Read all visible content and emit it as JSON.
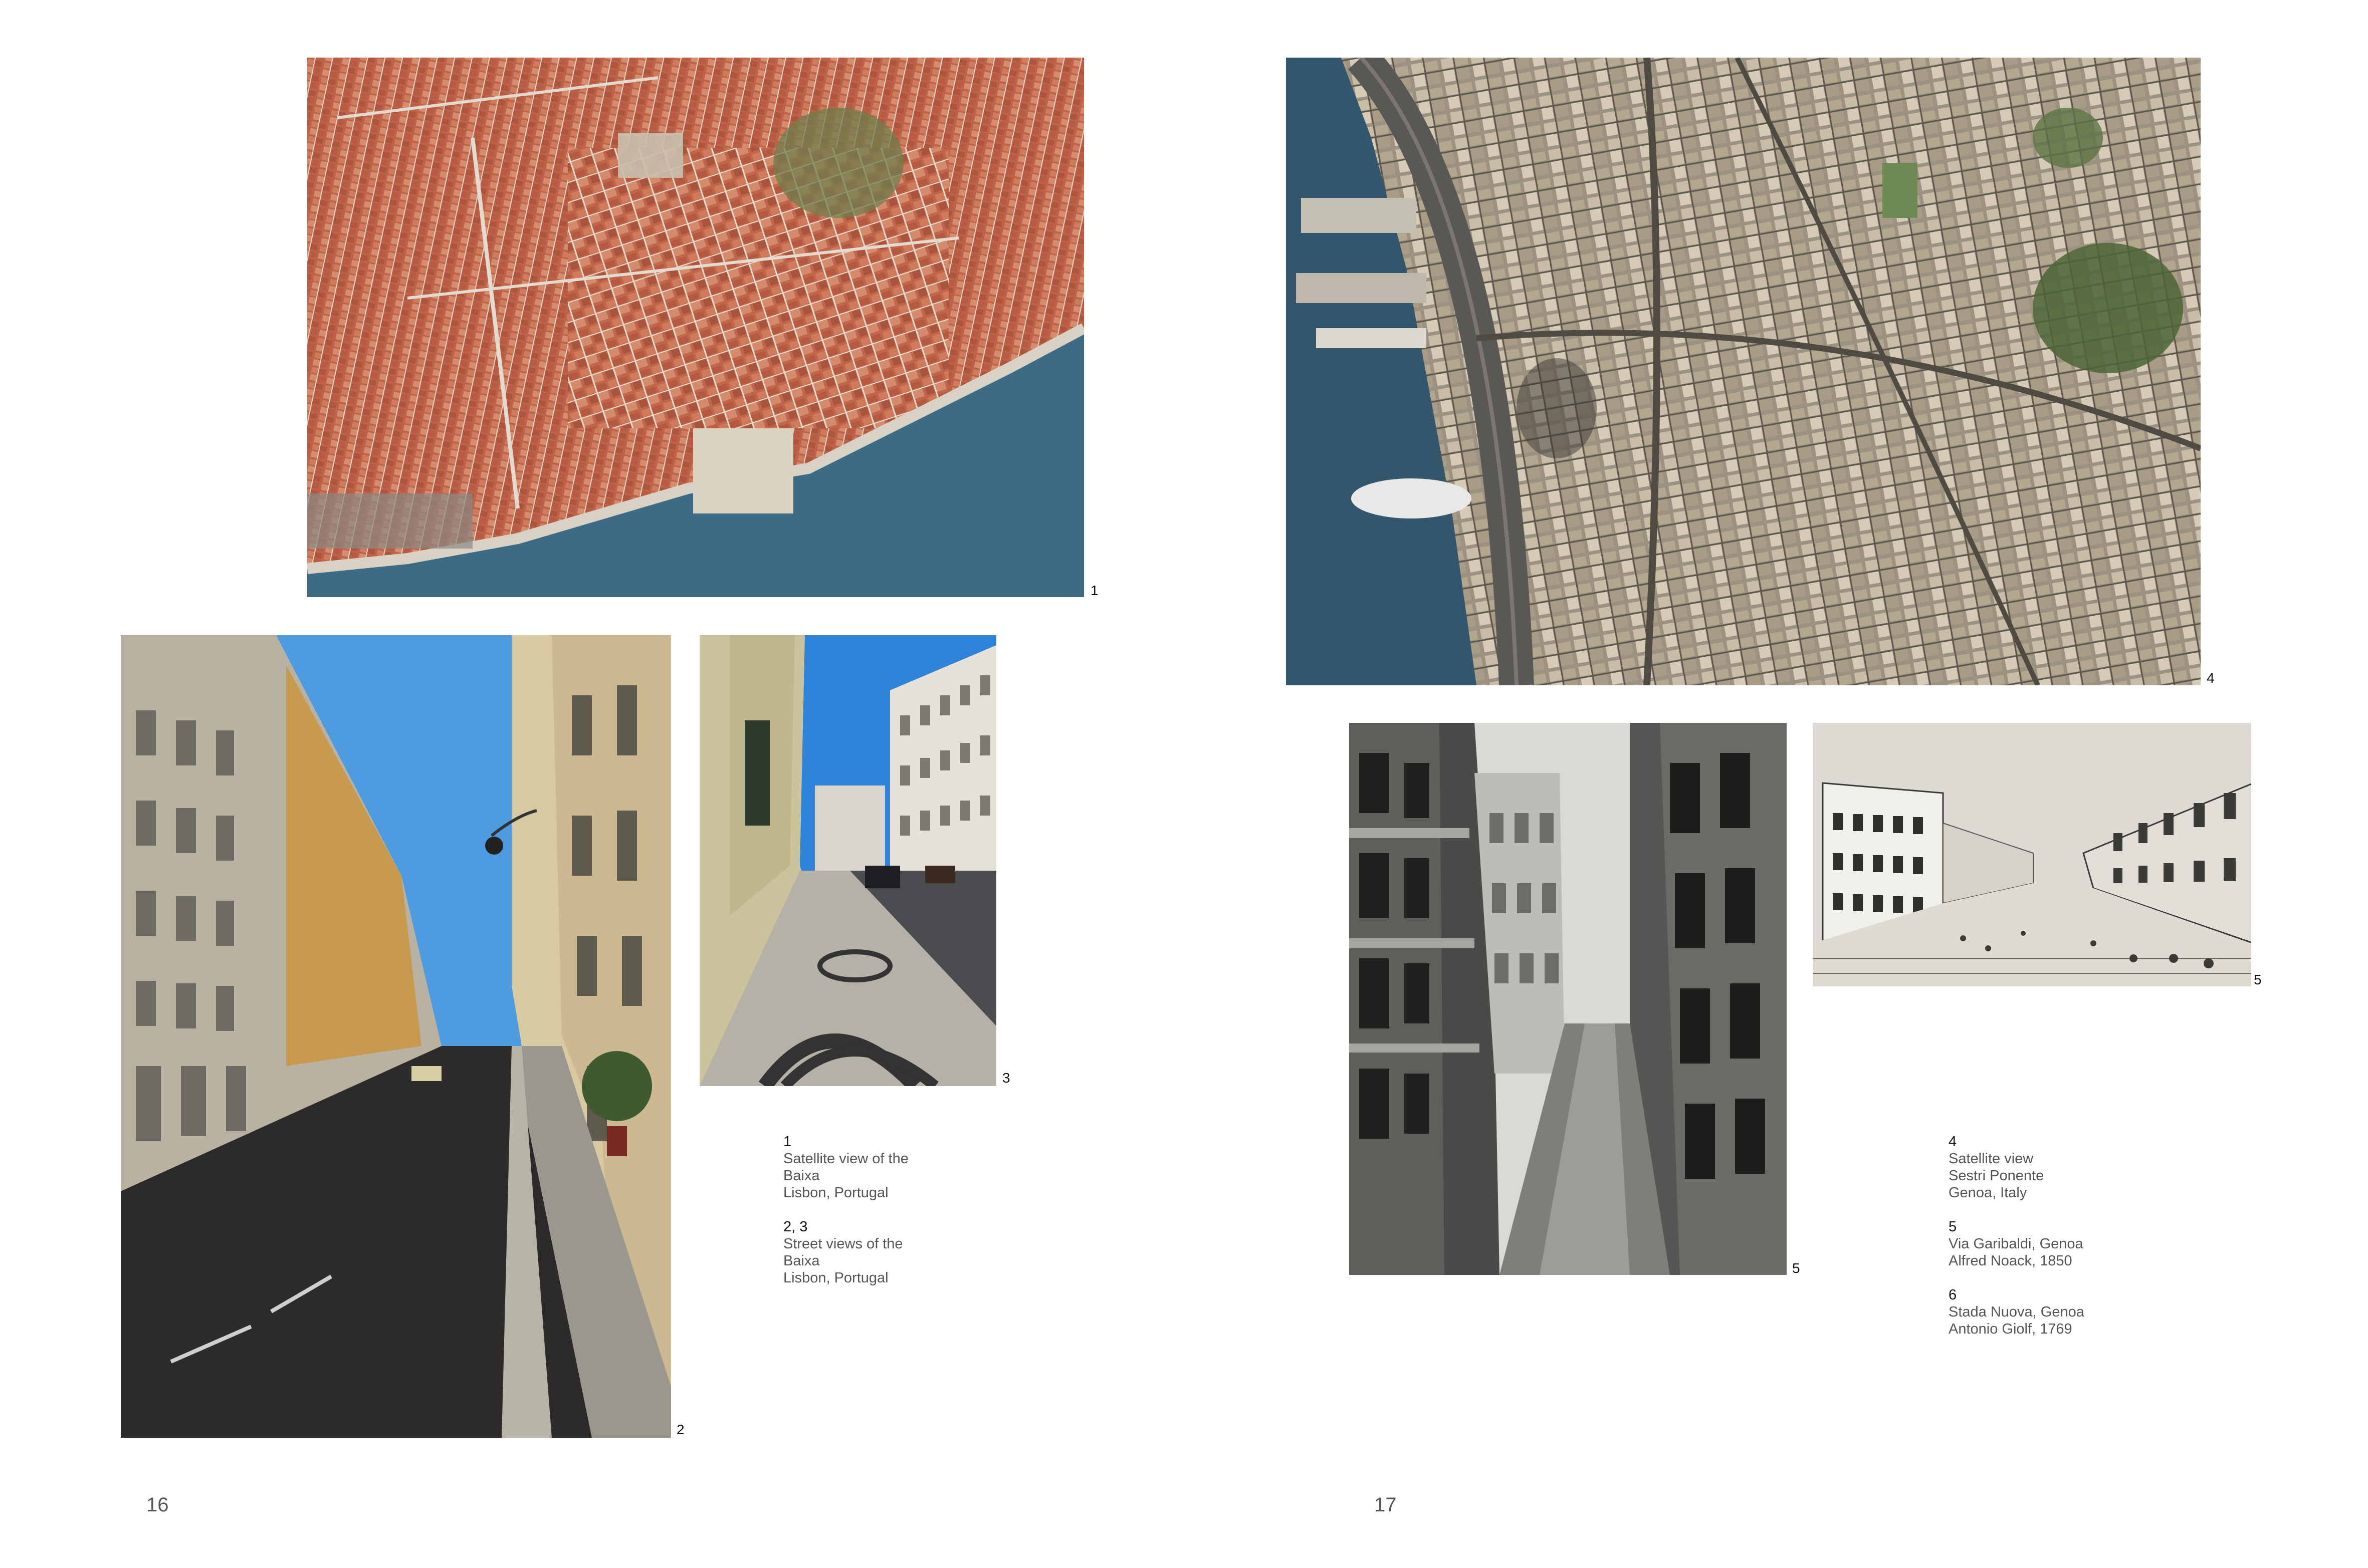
{
  "pages": {
    "left_folio": "16",
    "right_folio": "17"
  },
  "figures": {
    "fig1": {
      "number": "1",
      "subject": "Satellite view of the Baixa, Lisbon"
    },
    "fig2": {
      "number": "2",
      "subject": "Street view of the Baixa, Lisbon"
    },
    "fig3": {
      "number": "3",
      "subject": "Street view of the Baixa, Lisbon (mosaic pavement)"
    },
    "fig4": {
      "number": "4",
      "subject": "Satellite view of Genoa"
    },
    "fig5a": {
      "number": "5",
      "subject": "Via Garibaldi, Genoa photograph"
    },
    "fig5b": {
      "number": "5",
      "subject": "Strada Nuova engraving"
    }
  },
  "captions_left": [
    {
      "num": "1",
      "lines": [
        "Satellite view of the",
        "Baixa",
        "Lisbon, Portugal"
      ]
    },
    {
      "num": "2, 3",
      "lines": [
        "Street views of the",
        "Baixa",
        "Lisbon, Portugal"
      ]
    }
  ],
  "captions_right": [
    {
      "num": "4",
      "lines": [
        "Satellite view",
        "Sestri Ponente",
        "Genoa, Italy"
      ]
    },
    {
      "num": "5",
      "lines": [
        "Via Garibaldi, Genoa",
        "Alfred Noack, 1850"
      ]
    },
    {
      "num": "6",
      "lines": [
        "Stada Nuova, Genoa",
        "Antonio Giolf, 1769"
      ]
    }
  ],
  "colors": {
    "terracotta": "#c2644a",
    "sea": "#3d6b86",
    "sky": "#4f9be0",
    "sepia_dark": "#2a2a2a",
    "engraving_paper": "#e6e4de"
  }
}
